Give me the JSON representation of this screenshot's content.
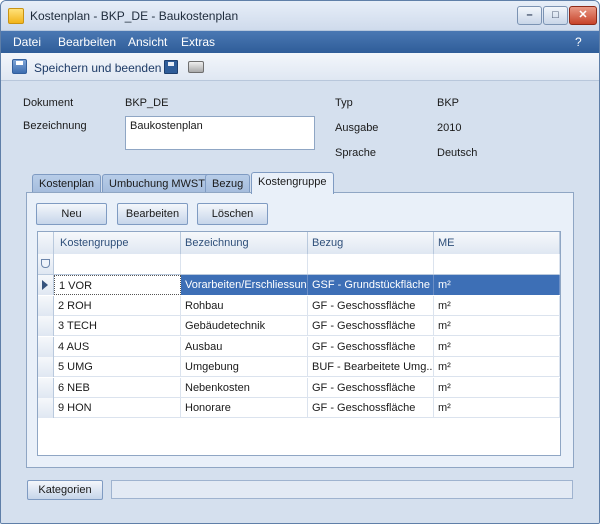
{
  "window": {
    "title": "Kostenplan - BKP_DE - Baukostenplan",
    "min": "–",
    "max": "□",
    "close": "✕"
  },
  "menu": {
    "items": [
      "Datei",
      "Bearbeiten",
      "Ansicht",
      "Extras"
    ],
    "help": "?"
  },
  "toolbar": {
    "save_close_label": "Speichern und beenden",
    "icons": [
      "save-close-icon",
      "save-icon",
      "print-icon"
    ]
  },
  "form": {
    "dokument_label": "Dokument",
    "dokument_value": "BKP_DE",
    "bezeichnung_label": "Bezeichnung",
    "bezeichnung_value": "Baukostenplan",
    "typ_label": "Typ",
    "typ_value": "BKP",
    "ausgabe_label": "Ausgabe",
    "ausgabe_value": "2010",
    "sprache_label": "Sprache",
    "sprache_value": "Deutsch"
  },
  "tabs": [
    "Kostenplan",
    "Umbuchung MWST",
    "Bezug",
    "Kostengruppe"
  ],
  "active_tab": "Kostengruppe",
  "buttons": {
    "neu": "Neu",
    "bearbeiten": "Bearbeiten",
    "loeschen": "Löschen",
    "kategorien": "Kategorien"
  },
  "table": {
    "columns": [
      "Kostengruppe",
      "Bezeichnung",
      "Bezug",
      "ME"
    ],
    "rows": [
      [
        "1 VOR",
        "Vorarbeiten/Erschliessung",
        "GSF - Grundstückfläche",
        "m²"
      ],
      [
        "2 ROH",
        "Rohbau",
        "GF - Geschossfläche",
        "m²"
      ],
      [
        "3 TECH",
        "Gebäudetechnik",
        "GF - Geschossfläche",
        "m²"
      ],
      [
        "4 AUS",
        "Ausbau",
        "GF - Geschossfläche",
        "m²"
      ],
      [
        "5 UMG",
        "Umgebung",
        "BUF - Bearbeitete Umg...",
        "m²"
      ],
      [
        "6 NEB",
        "Nebenkosten",
        "GF - Geschossfläche",
        "m²"
      ],
      [
        "9 HON",
        "Honorare",
        "GF - Geschossfläche",
        "m²"
      ]
    ],
    "selected_row": 0
  },
  "colors": {
    "menubar": "#2f5d99",
    "selection": "#3d6fb6",
    "background": "#d5e0ee"
  }
}
